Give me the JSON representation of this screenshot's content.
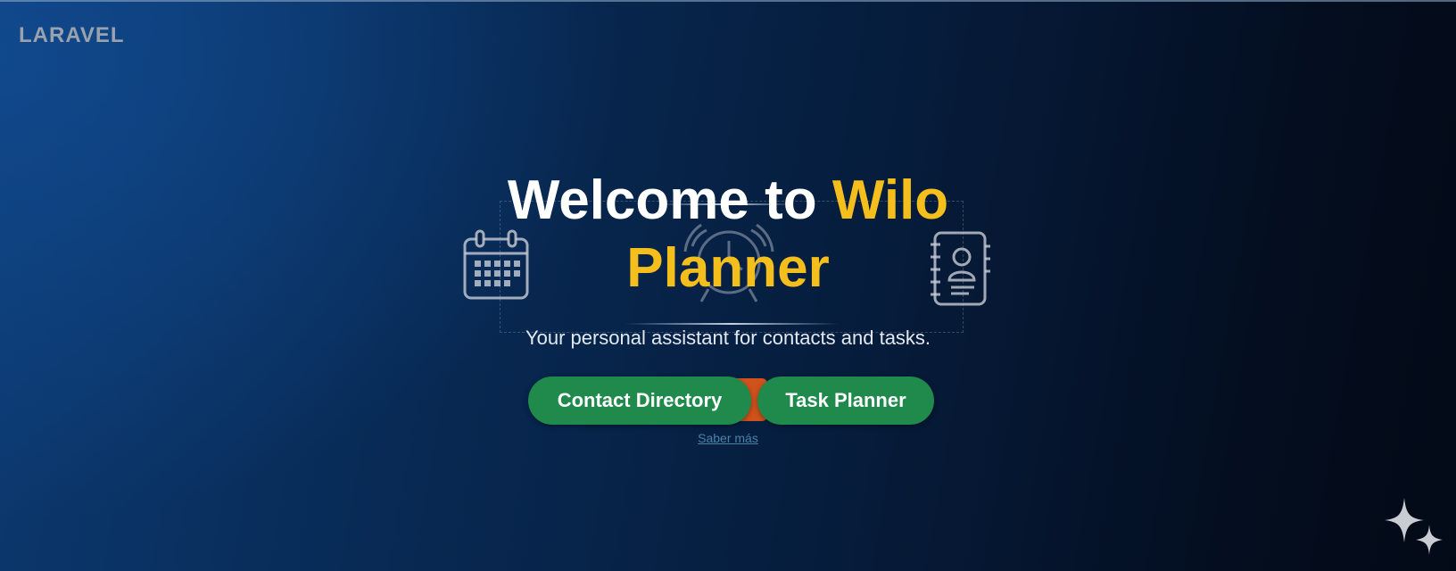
{
  "header": {
    "brand": "LARAVEL"
  },
  "hero": {
    "title_part1": "Welcome to ",
    "title_part2": "Wilo",
    "title_part3": "Planner",
    "subtitle": "Your personal assistant for contacts and tasks."
  },
  "actions": {
    "contact_directory": "Contact Directory",
    "task_planner": "Task Planner",
    "learn_more": "Saber más"
  },
  "icons": {
    "left": "calendar-icon",
    "center": "alarm-clock-icon",
    "right": "contact-book-icon",
    "corner": "sparkle-icon"
  },
  "colors": {
    "accent_yellow": "#f4bf1d",
    "button_green": "#1f8a4c",
    "background_dark": "#061c3b",
    "link_blue": "#4a82a8"
  }
}
